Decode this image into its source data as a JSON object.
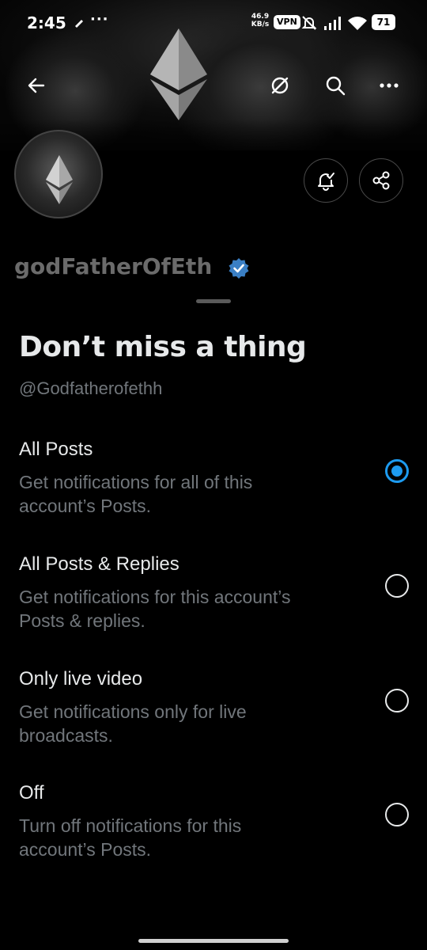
{
  "status_bar": {
    "time": "2:45",
    "overflow": "···",
    "net_speed_value": "46.9",
    "net_speed_unit": "KB/s",
    "vpn": "VPN",
    "battery": "71"
  },
  "header": {
    "back_icon": "arrow-left-icon",
    "grok_icon": "grok-icon",
    "search_icon": "search-icon",
    "more_icon": "more-icon"
  },
  "profile": {
    "name": "godFatherOfEth",
    "verified": true,
    "bell_icon": "notification-bell-icon",
    "share_icon": "share-icon"
  },
  "sheet": {
    "title": "Don’t miss a thing",
    "handle": "@Godfatherofethh",
    "options": [
      {
        "title": "All Posts",
        "desc_line1": "Get notifications for all of this",
        "desc_line2": "account’s Posts.",
        "selected": true
      },
      {
        "title": "All Posts & Replies",
        "desc_line1": "Get notifications for this account’s",
        "desc_line2": "Posts & replies.",
        "selected": false
      },
      {
        "title": "Only live video",
        "desc_line1": "Get notifications only for live",
        "desc_line2": "broadcasts.",
        "selected": false
      },
      {
        "title": "Off",
        "desc_line1": "Turn off notifications for this",
        "desc_line2": "account’s Posts.",
        "selected": false
      }
    ]
  },
  "colors": {
    "accent": "#1d9bf0",
    "background": "#000000",
    "text_primary": "#e7e9ea",
    "text_secondary": "#71767b"
  }
}
